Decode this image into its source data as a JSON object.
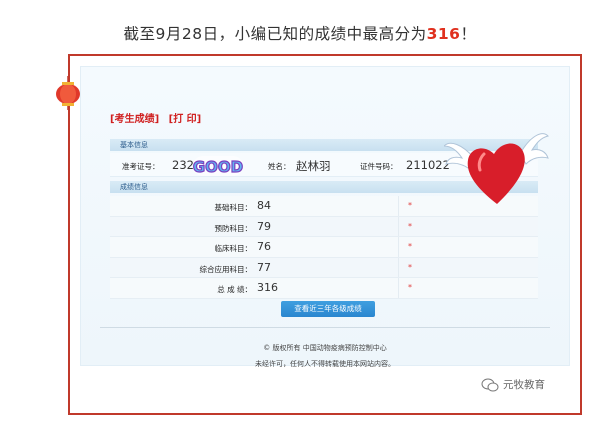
{
  "headline": {
    "prefix": "截至9月28日，小编已知的成绩中最高分为",
    "score": "316",
    "suffix": "！"
  },
  "top_links": {
    "results": "[考生成绩]",
    "print": "[打 印]"
  },
  "basic_section": {
    "title": "基本信息"
  },
  "candidate": {
    "exam_no_label": "准考证号：",
    "exam_no_value": "232",
    "name_label": "姓名：",
    "name_value": "赵林羽",
    "id_label": "证件号码：",
    "id_value": "211022"
  },
  "score_section": {
    "title": "成绩信息"
  },
  "scores": [
    {
      "label": "基础科目：",
      "value": "84",
      "mark": "*"
    },
    {
      "label": "预防科目：",
      "value": "79",
      "mark": "*"
    },
    {
      "label": "临床科目：",
      "value": "76",
      "mark": "*"
    },
    {
      "label": "综合应用科目：",
      "value": "77",
      "mark": "*"
    },
    {
      "label": "总 成 绩：",
      "value": "316",
      "mark": "*"
    }
  ],
  "history_button": "查看近三年各级成绩",
  "footer": {
    "copyright": "© 版权所有 中国动物疫病预防控制中心",
    "notice": "未经许可，任何人不得转载使用本网站内容。"
  },
  "sticker_text": "GOOD",
  "watermark": {
    "text": "元牧教育",
    "icon": "wechat-icon"
  },
  "colors": {
    "frame": "#c0392b",
    "accent_red": "#e0301e",
    "button": "#2a86cf"
  }
}
